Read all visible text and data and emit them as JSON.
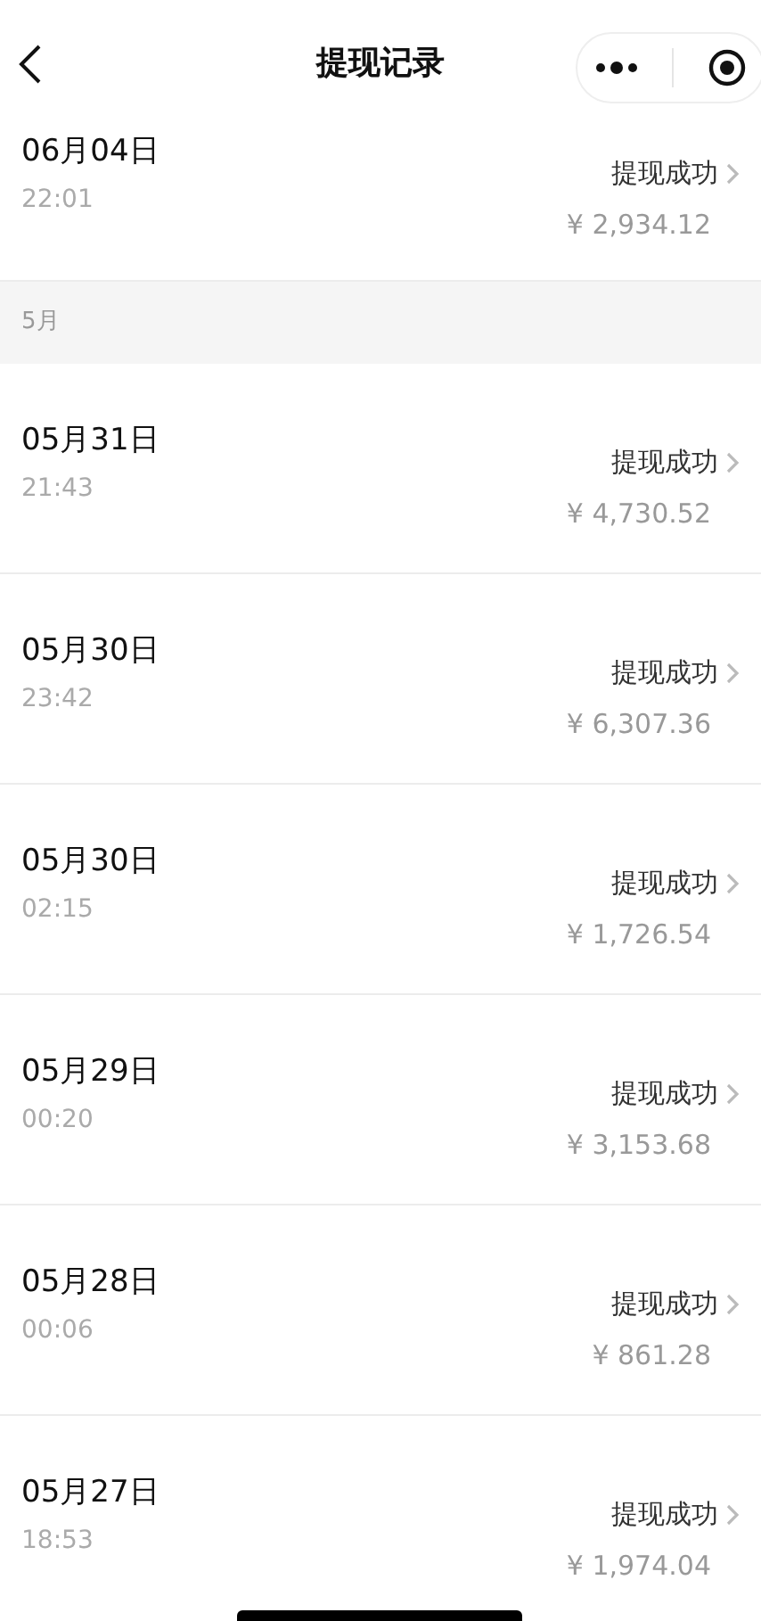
{
  "header": {
    "title": "提现记录"
  },
  "groups": [
    {
      "records": [
        {
          "date": "06月04日",
          "time": "22:01",
          "status": "提现成功",
          "amount": "¥ 2,934.12"
        }
      ]
    },
    {
      "month": "5月",
      "records": [
        {
          "date": "05月31日",
          "time": "21:43",
          "status": "提现成功",
          "amount": "¥ 4,730.52"
        },
        {
          "date": "05月30日",
          "time": "23:42",
          "status": "提现成功",
          "amount": "¥ 6,307.36"
        },
        {
          "date": "05月30日",
          "time": "02:15",
          "status": "提现成功",
          "amount": "¥ 1,726.54"
        },
        {
          "date": "05月29日",
          "time": "00:20",
          "status": "提现成功",
          "amount": "¥ 3,153.68"
        },
        {
          "date": "05月28日",
          "time": "00:06",
          "status": "提现成功",
          "amount": "¥ 861.28"
        },
        {
          "date": "05月27日",
          "time": "18:53",
          "status": "提现成功",
          "amount": "¥ 1,974.04"
        }
      ]
    }
  ]
}
